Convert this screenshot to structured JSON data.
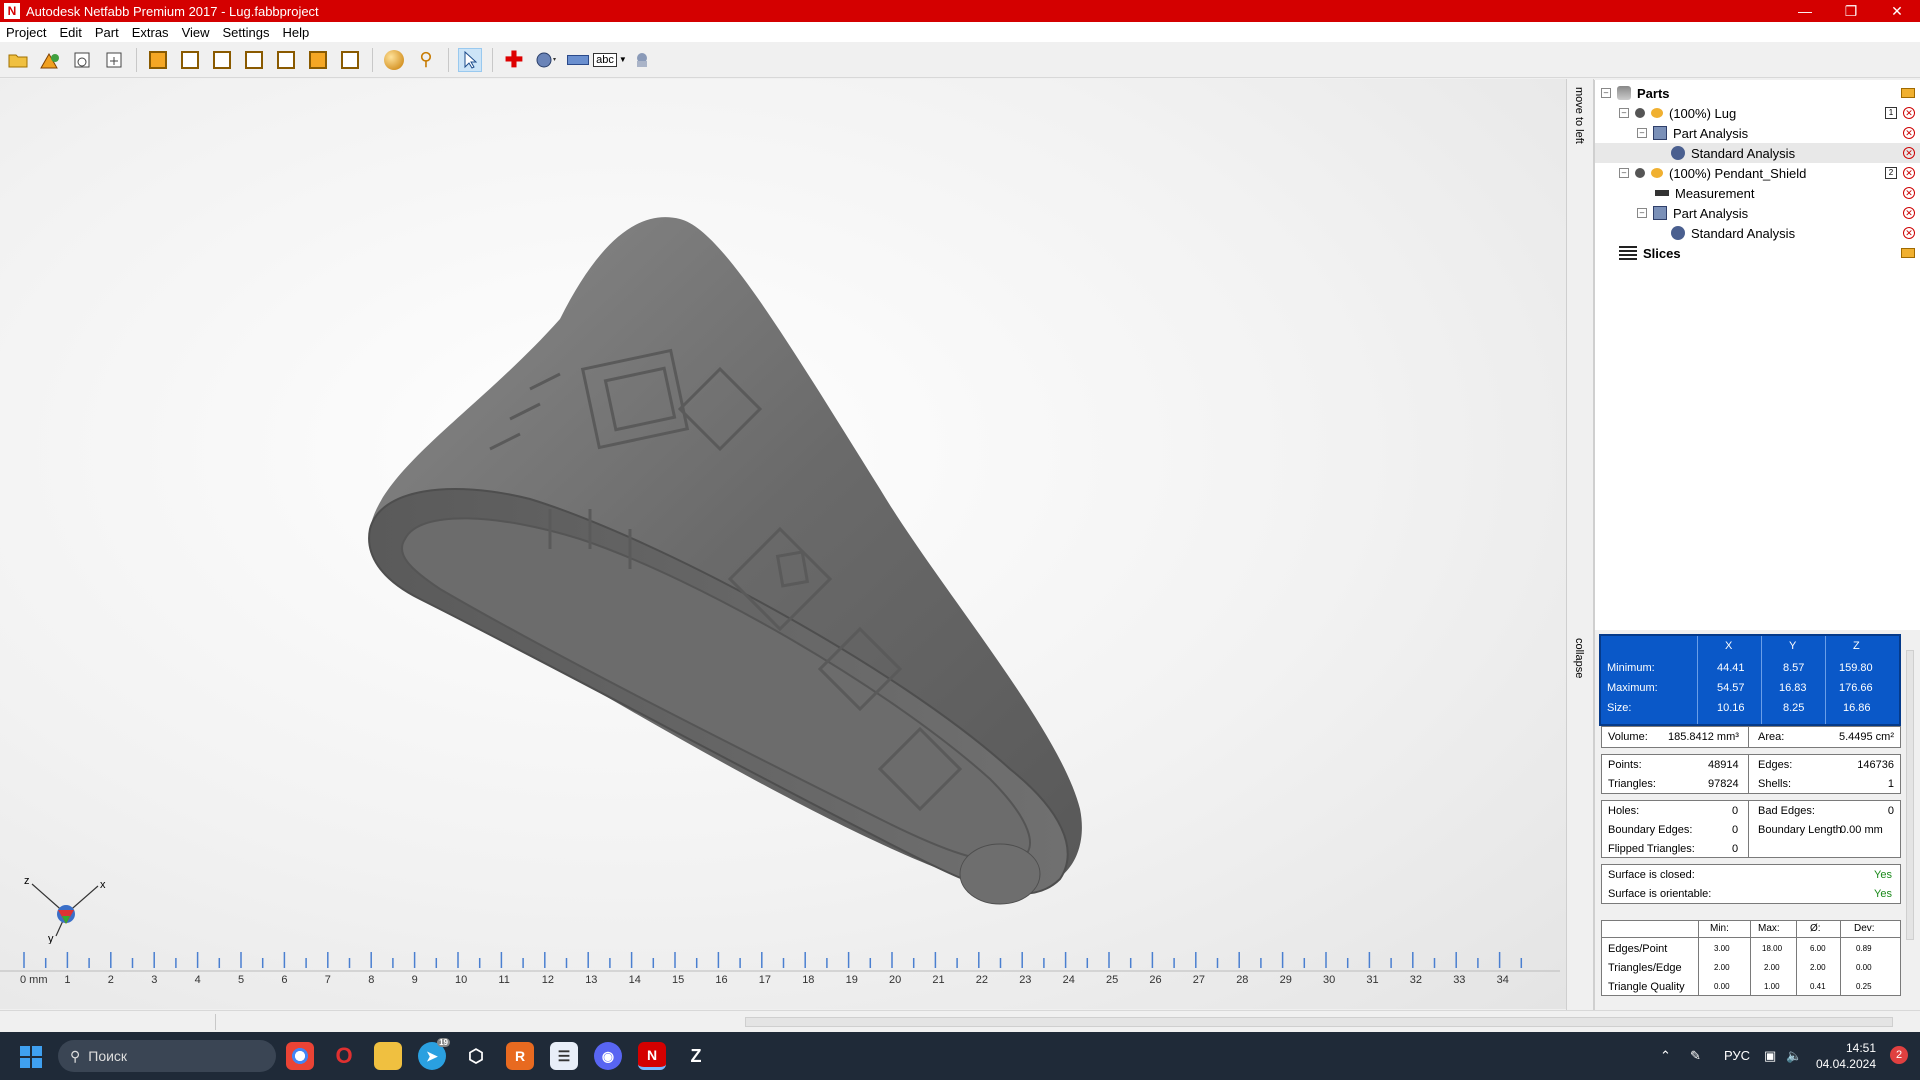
{
  "window": {
    "title": "Autodesk Netfabb Premium 2017 - Lug.fabbproject",
    "app_icon_letter": "N"
  },
  "menu": [
    "Project",
    "Edit",
    "Part",
    "Extras",
    "View",
    "Settings",
    "Help"
  ],
  "toolbar": {
    "icons": [
      "open-icon",
      "add-part-icon",
      "export-icon",
      "import-icon",
      "view-front-icon",
      "view-back-icon",
      "view-left-icon",
      "view-right-icon",
      "view-top-icon",
      "view-bottom-icon",
      "view-iso-icon",
      "shading-icon",
      "zoom-icon",
      "select-icon",
      "repair-icon",
      "analysis-icon",
      "measure-icon",
      "label-icon",
      "support-icon"
    ],
    "label_text": "abc"
  },
  "viewport": {
    "axis": {
      "x": "x",
      "y": "y",
      "z": "z"
    },
    "ruler_labels": [
      "0 mm",
      "1",
      "2",
      "3",
      "4",
      "5",
      "6",
      "7",
      "8",
      "9",
      "10",
      "11",
      "12",
      "13",
      "14",
      "15",
      "16",
      "17",
      "18",
      "19",
      "20",
      "21",
      "22",
      "23",
      "24",
      "25",
      "26",
      "27",
      "28",
      "29",
      "30",
      "31",
      "32",
      "33",
      "34"
    ]
  },
  "side_tabs": {
    "top": "move to left",
    "bottom": "collapse"
  },
  "tree": {
    "rows": [
      {
        "label": "Parts",
        "bold": true
      },
      {
        "label": "(100%) Lug"
      },
      {
        "label": "Part Analysis"
      },
      {
        "label": "Standard Analysis"
      },
      {
        "label": "(100%) Pendant_Shield"
      },
      {
        "label": "Measurement"
      },
      {
        "label": "Part Analysis"
      },
      {
        "label": "Standard Analysis"
      },
      {
        "label": "Slices",
        "bold": true
      }
    ],
    "lug_count": "1",
    "shield_count": "2"
  },
  "info": {
    "bbox": {
      "headers": [
        "X",
        "Y",
        "Z"
      ],
      "rows": [
        {
          "label": "Minimum:",
          "x": "44.41",
          "y": "8.57",
          "z": "159.80"
        },
        {
          "label": "Maximum:",
          "x": "54.57",
          "y": "16.83",
          "z": "176.66"
        },
        {
          "label": "Size:",
          "x": "10.16",
          "y": "8.25",
          "z": "16.86"
        }
      ]
    },
    "volume_label": "Volume:",
    "volume": "185.8412 mm³",
    "area_label": "Area:",
    "area": "5.4495 cm²",
    "points_label": "Points:",
    "points": "48914",
    "edges_label": "Edges:",
    "edges": "146736",
    "triangles_label": "Triangles:",
    "triangles": "97824",
    "shells_label": "Shells:",
    "shells": "1",
    "holes_label": "Holes:",
    "holes": "0",
    "bad_edges_label": "Bad Edges:",
    "bad_edges": "0",
    "boundary_edges_label": "Boundary Edges:",
    "boundary_edges": "0",
    "boundary_length_label": "Boundary Length",
    "boundary_length": "0.00 mm",
    "flipped_label": "Flipped Triangles:",
    "flipped": "0",
    "closed_label": "Surface is closed:",
    "closed": "Yes",
    "orientable_label": "Surface is orientable:",
    "orientable": "Yes",
    "quality": {
      "headers": [
        "Min:",
        "Max:",
        "Ø:",
        "Dev:"
      ],
      "rows": [
        {
          "label": "Edges/Point",
          "min": "3.00",
          "max": "18.00",
          "avg": "6.00",
          "dev": "0.89"
        },
        {
          "label": "Triangles/Edge",
          "min": "2.00",
          "max": "2.00",
          "avg": "2.00",
          "dev": "0.00"
        },
        {
          "label": "Triangle Quality",
          "min": "0.00",
          "max": "1.00",
          "avg": "0.41",
          "dev": "0.25"
        }
      ]
    }
  },
  "taskbar": {
    "search_placeholder": "Поиск",
    "lang": "РУС",
    "time": "14:51",
    "date": "04.04.2024",
    "notifications": "2",
    "telegram_badge": "19"
  }
}
